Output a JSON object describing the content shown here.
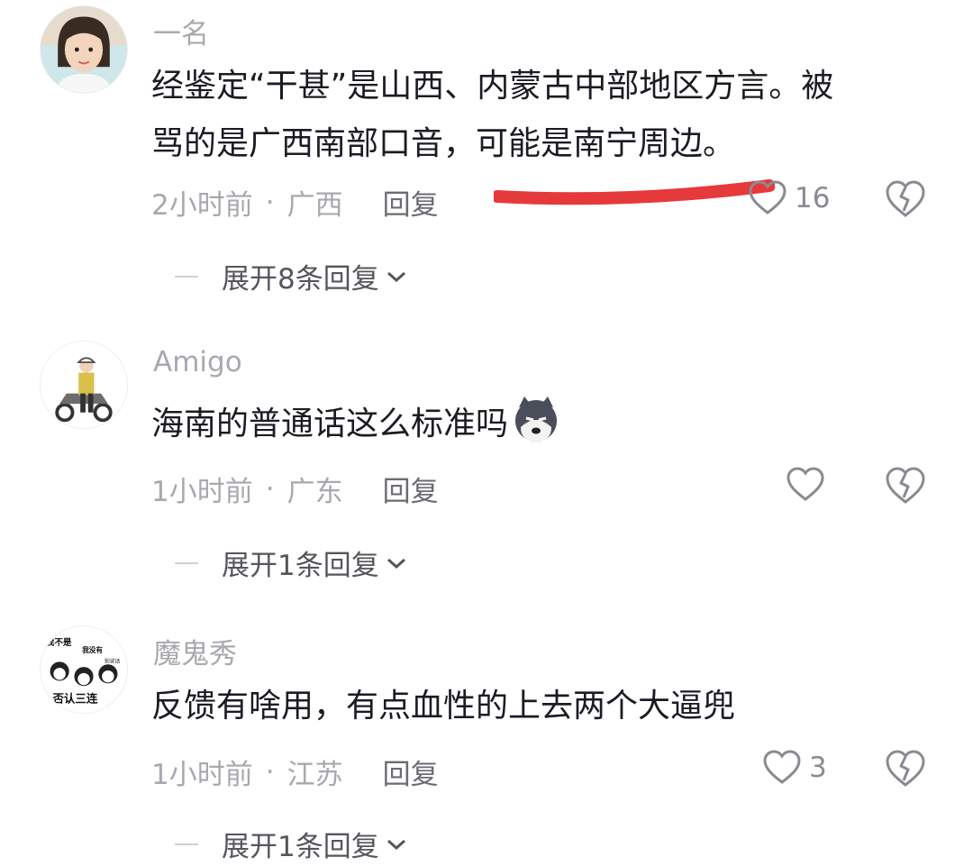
{
  "comments": [
    {
      "username": "一名",
      "content_lines": [
        "经鉴定“干甚”是山西、内蒙古中部地区方言。被",
        "骂的是广西南部口音，可能是南宁周边。"
      ],
      "time": "2小时前",
      "location": "广西",
      "reply_label": "回复",
      "likes": "16",
      "expand_label": "展开8条回复"
    },
    {
      "username": "Amigo",
      "content_lines": [
        "海南的普通话这么标准吗"
      ],
      "emoji": "husky-dog-emoji",
      "time": "1小时前",
      "location": "广东",
      "reply_label": "回复",
      "likes": "",
      "expand_label": "展开1条回复"
    },
    {
      "username": "魔鬼秀",
      "content_lines": [
        "反馈有啥用，有点血性的上去两个大逼兜"
      ],
      "time": "1小时前",
      "location": "江苏",
      "reply_label": "回复",
      "likes": "3",
      "expand_label": "展开1条回复",
      "avatar_text": [
        "我不是",
        "我没有",
        "别说话",
        "否认三连"
      ]
    }
  ],
  "separator": "·",
  "icons": {
    "like": "heart-outline-icon",
    "dislike": "broken-heart-icon",
    "expand": "chevron-down-icon"
  },
  "colors": {
    "text_primary": "#1b1c22",
    "text_secondary": "#a8a9ae",
    "annotation_red": "#e5393c"
  }
}
